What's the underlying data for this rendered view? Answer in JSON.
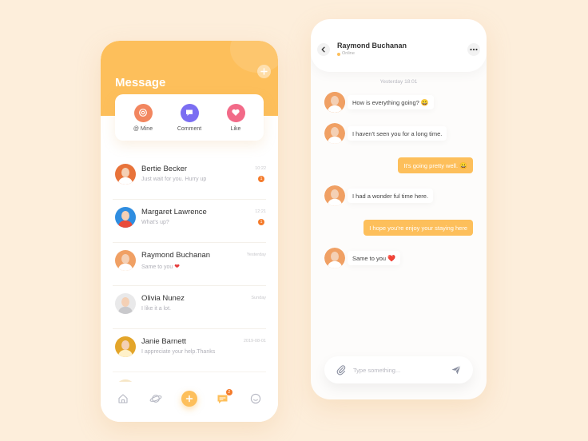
{
  "left": {
    "title": "Message",
    "quick_actions": [
      {
        "label": "@ Mine",
        "icon": "at-icon",
        "color": "#f2865f"
      },
      {
        "label": "Comment",
        "icon": "comment-icon",
        "color": "#7b6ef2"
      },
      {
        "label": "Like",
        "icon": "heart-icon",
        "color": "#f26a88"
      }
    ],
    "conversations": [
      {
        "name": "Bertie Becker",
        "preview": "Just wait for you. Hurry up",
        "time": "10:22",
        "badge": "1",
        "avatar_bg": "#e8733a"
      },
      {
        "name": "Margaret Lawrence",
        "preview": "What's up?",
        "time": "12:21",
        "badge": "1",
        "avatar_bg": "#2f8de0"
      },
      {
        "name": "Raymond Buchanan",
        "preview": "Same to you",
        "preview_emoji": "❤",
        "time": "Yesterday",
        "badge": "",
        "avatar_bg": "#f0a064"
      },
      {
        "name": "Olivia Nunez",
        "preview": "I like it a lot.",
        "time": "Sunday",
        "badge": "",
        "avatar_bg": "#e9e9ea"
      },
      {
        "name": "Janie Barnett",
        "preview": "I appreciate your help.Thanks",
        "time": "2019-08-01",
        "badge": "",
        "avatar_bg": "#e3a52a"
      }
    ],
    "tabbar": {
      "items": [
        {
          "icon": "home-icon"
        },
        {
          "icon": "planet-icon"
        },
        {
          "icon": "add-icon"
        },
        {
          "icon": "message-icon",
          "badge": "2"
        },
        {
          "icon": "smile-icon"
        }
      ]
    }
  },
  "right": {
    "contact_name": "Raymond Buchanan",
    "status": "Online",
    "day_separator": "Yesterday 18:01",
    "messages": [
      {
        "direction": "in",
        "text": "How is everything going?",
        "emoji": "😀"
      },
      {
        "direction": "in",
        "text": "I haven't seen you for a long time.",
        "emoji": ""
      },
      {
        "direction": "out",
        "text": "It's going pretty well.",
        "emoji": "😀"
      },
      {
        "direction": "in",
        "text": "I had a wonder ful time here.",
        "emoji": ""
      },
      {
        "direction": "out",
        "text": "I hope you're enjoy your staying here",
        "emoji": ""
      },
      {
        "direction": "in",
        "text": "Same to you",
        "emoji": "❤️"
      }
    ],
    "input_placeholder": "Type something...",
    "accent": "#fdbf5b"
  }
}
